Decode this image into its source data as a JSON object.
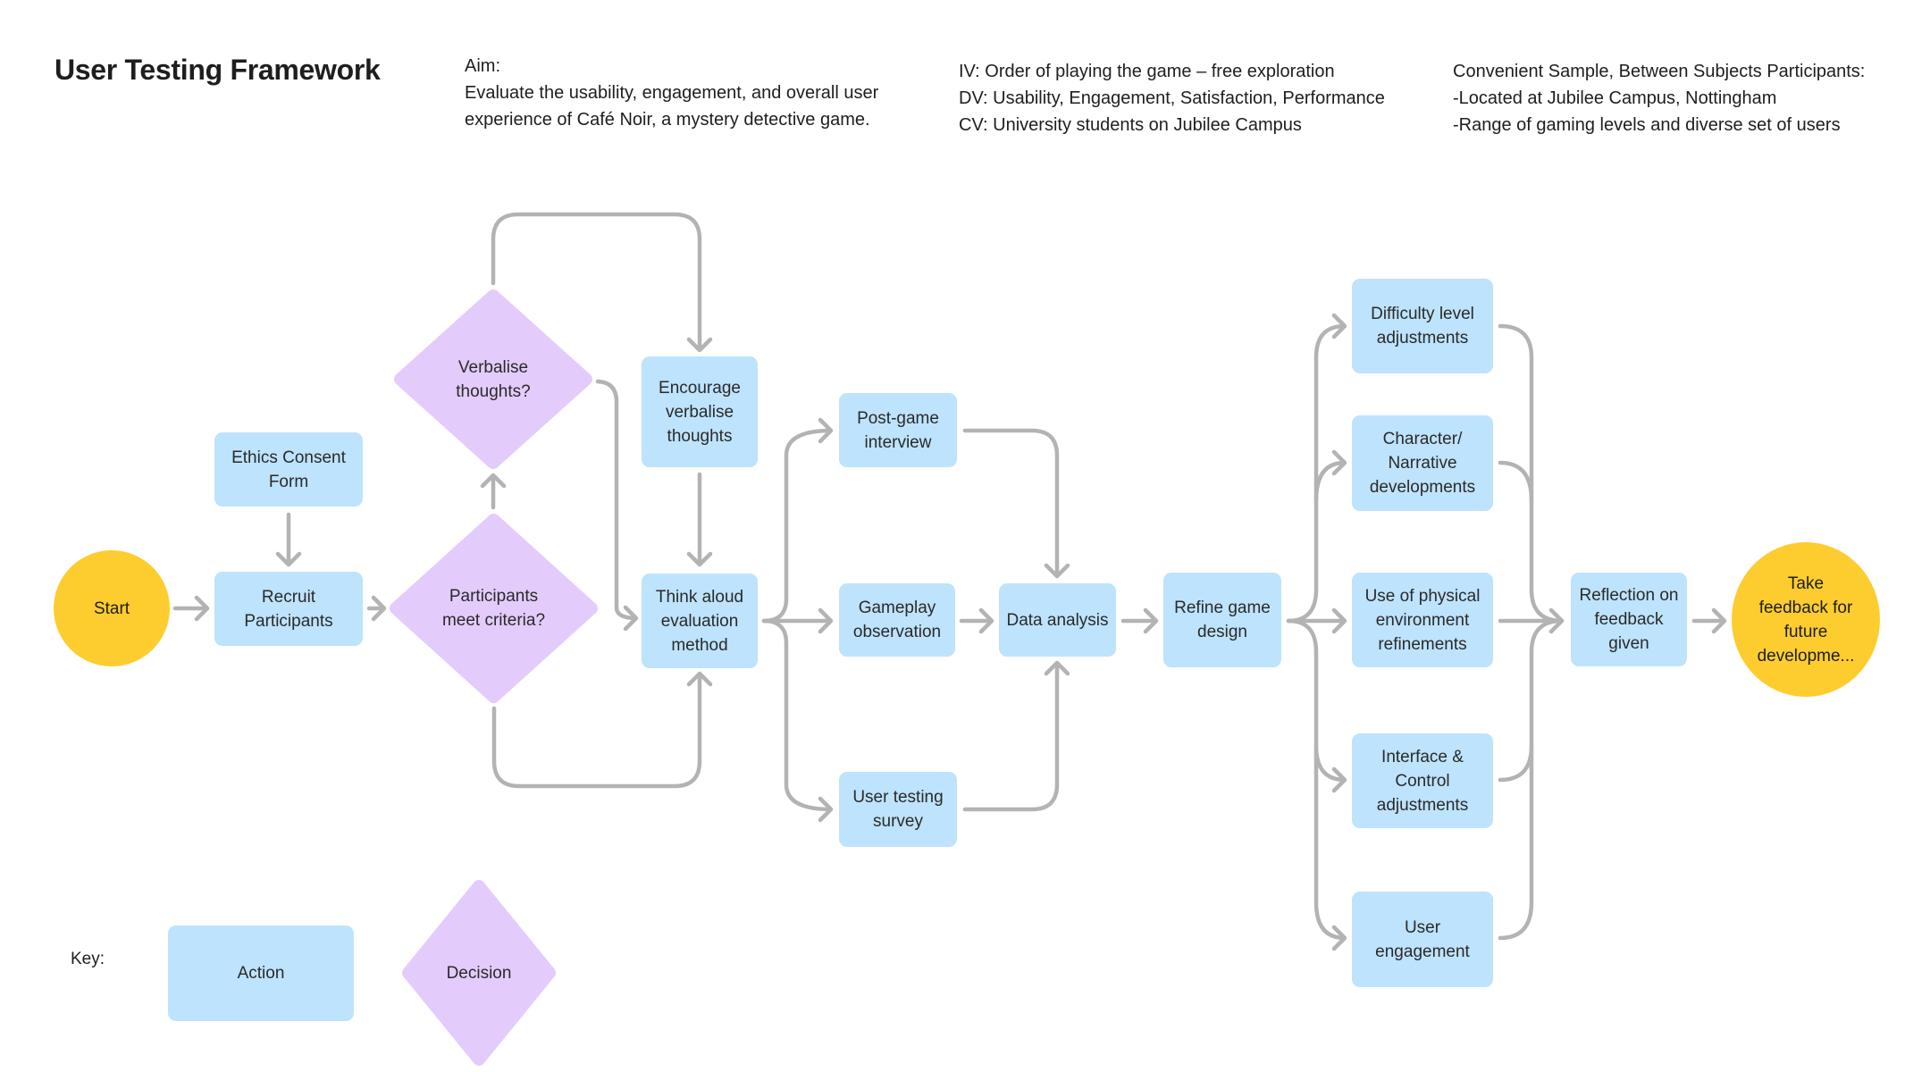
{
  "header": {
    "title": "User Testing Framework",
    "aim": [
      "Aim:",
      "Evaluate the usability, engagement, and overall user",
      "experience of Café Noir, a mystery detective game."
    ],
    "variables": [
      "IV: Order of playing the game – free exploration",
      "DV: Usability, Engagement, Satisfaction, Performance",
      "CV: University students on Jubilee Campus"
    ],
    "sample": [
      "Convenient Sample, Between Subjects Participants:",
      "-Located at Jubilee Campus, Nottingham",
      "-Range of gaming levels and diverse set of users"
    ]
  },
  "colors": {
    "action": "#bee3fc",
    "decision": "#e3ccfb",
    "terminal": "#fdcc2e",
    "connector": "#b3b3b3",
    "text": "#1e1e1e"
  },
  "nodes": {
    "start": {
      "type": "terminal",
      "label": "Start"
    },
    "ethics": {
      "type": "action",
      "label": "Ethics Consent Form"
    },
    "recruit": {
      "type": "action",
      "label": "Recruit Participants"
    },
    "criteria": {
      "type": "decision",
      "label": "Participants meet criteria?"
    },
    "verbalise": {
      "type": "decision",
      "label": "Verbalise thoughts?"
    },
    "encourage": {
      "type": "action",
      "label": "Encourage verbalise thoughts"
    },
    "think_aloud": {
      "type": "action",
      "label": "Think aloud evaluation method"
    },
    "post_game": {
      "type": "action",
      "label": "Post-game interview"
    },
    "gameplay": {
      "type": "action",
      "label": "Gameplay observation"
    },
    "survey": {
      "type": "action",
      "label": "User testing survey"
    },
    "data_analysis": {
      "type": "action",
      "label": "Data analysis"
    },
    "refine": {
      "type": "action",
      "label": "Refine game design"
    },
    "difficulty": {
      "type": "action",
      "label": "Difficulty level adjustments"
    },
    "character": {
      "type": "action",
      "label": "Character/ Narrative developments"
    },
    "physical": {
      "type": "action",
      "label": "Use of physical environment refinements"
    },
    "interface": {
      "type": "action",
      "label": "Interface & Control adjustments"
    },
    "engagement": {
      "type": "action",
      "label": "User engagement"
    },
    "reflection": {
      "type": "action",
      "label": "Reflection on feedback given"
    },
    "take_feedback": {
      "type": "terminal",
      "label": "Take feedback for future developme..."
    }
  },
  "edges": [
    [
      "start",
      "recruit"
    ],
    [
      "ethics",
      "recruit"
    ],
    [
      "recruit",
      "criteria"
    ],
    [
      "criteria",
      "verbalise"
    ],
    [
      "criteria",
      "think_aloud"
    ],
    [
      "verbalise",
      "encourage"
    ],
    [
      "verbalise",
      "think_aloud"
    ],
    [
      "encourage",
      "think_aloud"
    ],
    [
      "think_aloud",
      "post_game"
    ],
    [
      "think_aloud",
      "gameplay"
    ],
    [
      "think_aloud",
      "survey"
    ],
    [
      "post_game",
      "data_analysis"
    ],
    [
      "gameplay",
      "data_analysis"
    ],
    [
      "survey",
      "data_analysis"
    ],
    [
      "data_analysis",
      "refine"
    ],
    [
      "refine",
      "difficulty"
    ],
    [
      "refine",
      "character"
    ],
    [
      "refine",
      "physical"
    ],
    [
      "refine",
      "interface"
    ],
    [
      "refine",
      "engagement"
    ],
    [
      "difficulty",
      "reflection"
    ],
    [
      "character",
      "reflection"
    ],
    [
      "physical",
      "reflection"
    ],
    [
      "interface",
      "reflection"
    ],
    [
      "engagement",
      "reflection"
    ],
    [
      "reflection",
      "take_feedback"
    ]
  ],
  "key": {
    "label": "Key:",
    "action": "Action",
    "decision": "Decision"
  }
}
